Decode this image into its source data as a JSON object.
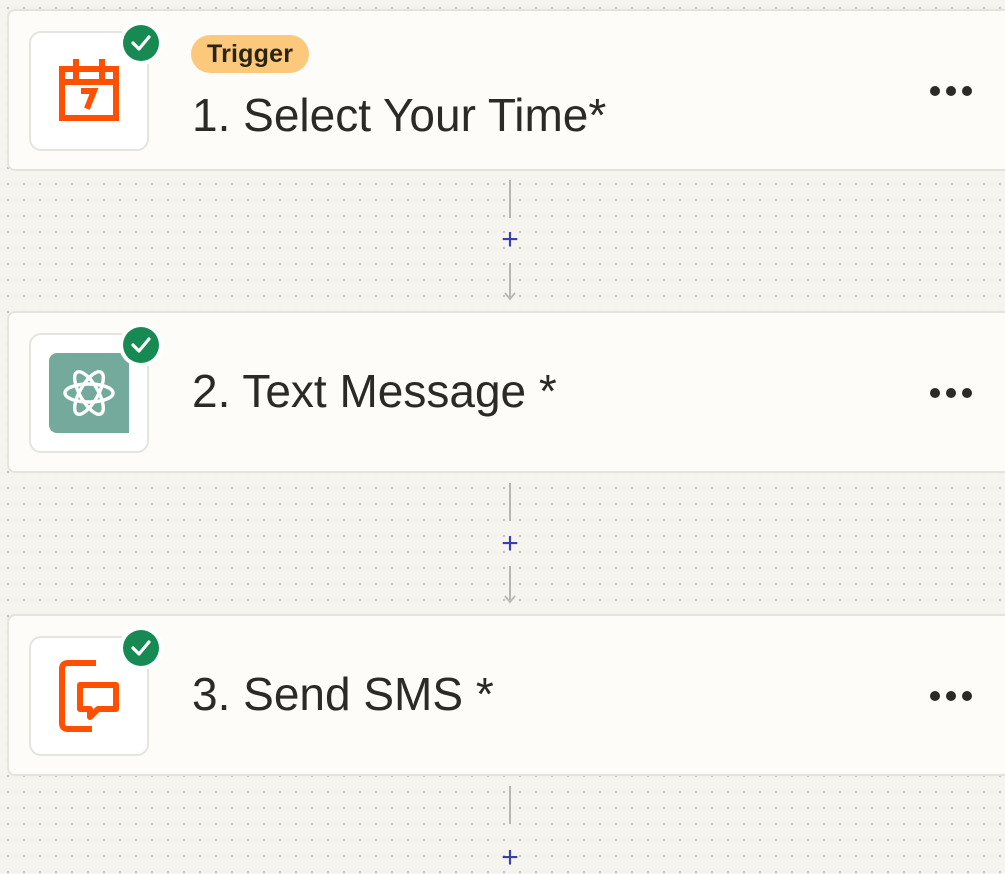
{
  "steps": [
    {
      "number": "1.",
      "title": "1. Select Your Time*",
      "badge": "Trigger",
      "app_icon": "schedule-calendar-icon",
      "status": "complete"
    },
    {
      "number": "2.",
      "title": "2. Text Message *",
      "app_icon": "openai-chatgpt-icon",
      "status": "complete"
    },
    {
      "number": "3.",
      "title": "3. Send SMS *",
      "app_icon": "sms-message-icon",
      "status": "complete"
    }
  ],
  "connector": {
    "add_symbol": "+"
  },
  "colors": {
    "canvas_bg": "#f5f4ef",
    "card_bg": "#fdfcf9",
    "check_green": "#168a52",
    "trigger_badge": "#fcc97c",
    "brand_orange": "#ff4f00",
    "openai_green": "#74aa9c",
    "add_blue": "#3b3fa8"
  }
}
